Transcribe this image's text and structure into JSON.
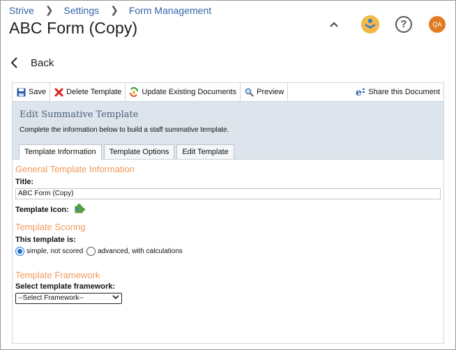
{
  "breadcrumb": {
    "items": [
      "Strive",
      "Settings",
      "Form Management"
    ]
  },
  "header": {
    "title": "ABC Form (Copy)",
    "user_initials": "QA",
    "help_glyph": "?"
  },
  "nav": {
    "back_label": "Back"
  },
  "toolbar": {
    "save": "Save",
    "delete": "Delete Template",
    "update": "Update Existing Documents",
    "preview": "Preview",
    "share": "Share this Document"
  },
  "editor": {
    "heading": "Edit Summative Template",
    "subheading": "Complete the information below to build a staff summative template.",
    "tabs": [
      "Template Information",
      "Template Options",
      "Edit Template"
    ],
    "active_tab": "Template Information"
  },
  "form": {
    "general_section": "General Template Information",
    "title_label": "Title:",
    "title_value": "ABC Form (Copy)",
    "icon_label": "Template Icon:",
    "scoring_section": "Template Scoring",
    "scoring_label": "This template is:",
    "scoring_options": [
      "simple, not scored",
      "advanced, with calculations"
    ],
    "scoring_selected": "simple, not scored",
    "framework_section": "Template Framework",
    "framework_label": "Select template framework:",
    "framework_selected": "--Select Framework--"
  },
  "colors": {
    "link": "#2f63a7",
    "section": "#f0995a",
    "panel_head": "#dde4ec",
    "avatar": "#e07b25"
  }
}
